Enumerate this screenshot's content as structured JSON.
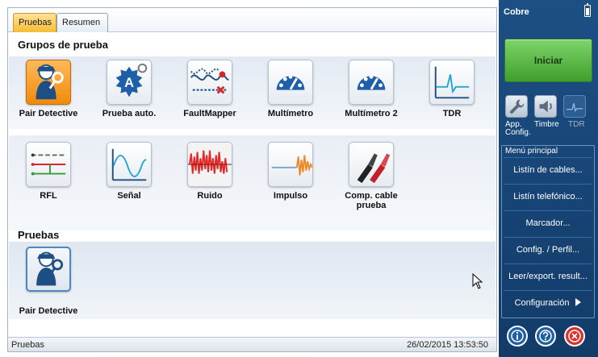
{
  "tabs": [
    {
      "label": "Pruebas",
      "active": true
    },
    {
      "label": "Resumen",
      "active": false
    }
  ],
  "sections": {
    "groups_title": "Grupos de prueba",
    "tests_title": "Pruebas"
  },
  "groups": [
    {
      "label": "Pair Detective",
      "icon": "pair-detective-icon",
      "selected": true
    },
    {
      "label": "Prueba auto.",
      "icon": "auto-test-icon"
    },
    {
      "label": "FaultMapper",
      "icon": "faultmapper-icon"
    },
    {
      "label": "Multímetro",
      "icon": "multimeter-icon"
    },
    {
      "label": "Multímetro 2",
      "icon": "multimeter-2-icon"
    },
    {
      "label": "TDR",
      "icon": "tdr-icon"
    },
    {
      "label": "RFL",
      "icon": "rfl-icon"
    },
    {
      "label": "Señal",
      "icon": "signal-icon"
    },
    {
      "label": "Ruido",
      "icon": "noise-icon"
    },
    {
      "label": "Impulso",
      "icon": "impulse-icon"
    },
    {
      "label": "Comp. cable prueba",
      "icon": "test-leads-icon"
    }
  ],
  "tests": [
    {
      "label": "Pair Detective",
      "icon": "pair-detective-icon"
    }
  ],
  "status": {
    "text": "Pruebas",
    "datetime": "26/02/2015 13:53:50"
  },
  "panel": {
    "title": "Cobre",
    "start_label": "Iniciar",
    "tools": [
      {
        "label": "App. Config.",
        "icon": "wrench-icon"
      },
      {
        "label": "Timbre",
        "icon": "speaker-icon"
      },
      {
        "label": "TDR",
        "icon": "tdr-mini-icon",
        "enabled": false
      }
    ],
    "menu_title": "Menú principal",
    "menu_items": [
      "Listín de cables...",
      "Listín telefónico...",
      "Marcador...",
      "Config. / Perfil...",
      "Leer/export. result...",
      "Configuración"
    ]
  },
  "colors": {
    "panel_bg": "#1d4f85",
    "start_button": "#4caf35",
    "selected_tile": "#f59a1e",
    "close_button": "#d9302a"
  }
}
